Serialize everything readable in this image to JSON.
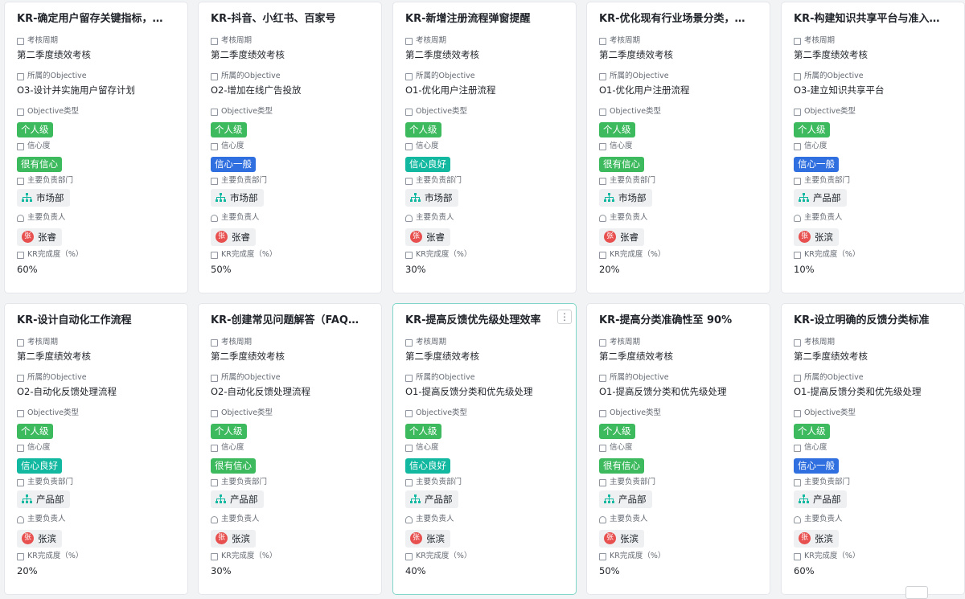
{
  "labels": {
    "period": "考核周期",
    "objective": "所属的Objective",
    "objective_type": "Objective类型",
    "confidence": "信心度",
    "department": "主要负责部门",
    "owner": "主要负责人",
    "completion": "KR完成度（%）"
  },
  "colors": {
    "个人级": "#3dba5e",
    "很有信心": "#3dba5e",
    "信心一般": "#2f6fe0",
    "信心良好": "#13b8a0",
    "accent": "#7fd6c8"
  },
  "icons": {
    "field": "calendar-icon",
    "department": "org-chart-icon",
    "owner": "user-icon",
    "more": "more-vertical-icon"
  },
  "more_button_label": "⋮",
  "cards": [
    {
      "title": "KR-确定用户留存关键指标，制…",
      "period": "第二季度绩效考核",
      "objective": "O3-设计并实施用户留存计划",
      "objective_type": "个人级",
      "confidence": "很有信心",
      "department": "市场部",
      "owner": "张睿",
      "owner_initial": "张",
      "completion": "60%"
    },
    {
      "title": "KR-抖音、小红书、百家号",
      "period": "第二季度绩效考核",
      "objective": "O2-增加在线广告投放",
      "objective_type": "个人级",
      "confidence": "信心一般",
      "department": "市场部",
      "owner": "张睿",
      "owner_initial": "张",
      "completion": "50%"
    },
    {
      "title": "KR-新增注册流程弹窗提醒",
      "period": "第二季度绩效考核",
      "objective": "O1-优化用户注册流程",
      "objective_type": "个人级",
      "confidence": "信心良好",
      "department": "市场部",
      "owner": "张睿",
      "owner_initial": "张",
      "completion": "30%"
    },
    {
      "title": "KR-优化现有行业场景分类，用…",
      "period": "第二季度绩效考核",
      "objective": "O1-优化用户注册流程",
      "objective_type": "个人级",
      "confidence": "很有信心",
      "department": "市场部",
      "owner": "张睿",
      "owner_initial": "张",
      "completion": "20%"
    },
    {
      "title": "KR-构建知识共享平台与准入标准",
      "period": "第二季度绩效考核",
      "objective": "O3-建立知识共享平台",
      "objective_type": "个人级",
      "confidence": "信心一般",
      "department": "产品部",
      "owner": "张滨",
      "owner_initial": "张",
      "completion": "10%"
    },
    {
      "title": "KR-设计自动化工作流程",
      "period": "第二季度绩效考核",
      "objective": "O2-自动化反馈处理流程",
      "objective_type": "个人级",
      "confidence": "信心良好",
      "department": "产品部",
      "owner": "张滨",
      "owner_initial": "张",
      "completion": "20%"
    },
    {
      "title": "KR-创建常见问题解答（FAQ）…",
      "period": "第二季度绩效考核",
      "objective": "O2-自动化反馈处理流程",
      "objective_type": "个人级",
      "confidence": "很有信心",
      "department": "产品部",
      "owner": "张滨",
      "owner_initial": "张",
      "completion": "30%"
    },
    {
      "title": "KR-提高反馈优先级处理效率",
      "period": "第二季度绩效考核",
      "objective": "O1-提高反馈分类和优先级处理",
      "objective_type": "个人级",
      "confidence": "信心良好",
      "department": "产品部",
      "owner": "张滨",
      "owner_initial": "张",
      "completion": "40%",
      "selected": true
    },
    {
      "title": "KR-提高分类准确性至 90%",
      "period": "第二季度绩效考核",
      "objective": "O1-提高反馈分类和优先级处理",
      "objective_type": "个人级",
      "confidence": "很有信心",
      "department": "产品部",
      "owner": "张滨",
      "owner_initial": "张",
      "completion": "50%"
    },
    {
      "title": "KR-设立明确的反馈分类标准",
      "period": "第二季度绩效考核",
      "objective": "O1-提高反馈分类和优先级处理",
      "objective_type": "个人级",
      "confidence": "信心一般",
      "department": "产品部",
      "owner": "张滨",
      "owner_initial": "张",
      "completion": "60%"
    }
  ]
}
